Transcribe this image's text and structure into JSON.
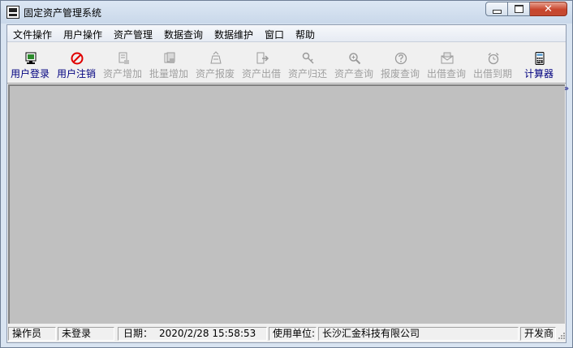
{
  "window": {
    "title": "固定资产管理系统",
    "colors": {
      "title_bar": "#c9d8ea",
      "close_button": "#c8452d",
      "workspace": "#c0c0c0"
    }
  },
  "menu": [
    {
      "label": "文件操作"
    },
    {
      "label": "用户操作"
    },
    {
      "label": "资产管理"
    },
    {
      "label": "数据查询"
    },
    {
      "label": "数据维护"
    },
    {
      "label": "窗口"
    },
    {
      "label": "帮助"
    }
  ],
  "toolbar": [
    {
      "label": "用户登录",
      "icon": "monitor-icon",
      "enabled": true
    },
    {
      "label": "用户注销",
      "icon": "no-entry-icon",
      "enabled": true
    },
    {
      "label": "资产增加",
      "icon": "doc-add-icon",
      "enabled": false
    },
    {
      "label": "批量增加",
      "icon": "batch-add-icon",
      "enabled": false
    },
    {
      "label": "资产报废",
      "icon": "scrap-icon",
      "enabled": false
    },
    {
      "label": "资产出借",
      "icon": "lend-icon",
      "enabled": false
    },
    {
      "label": "资产归还",
      "icon": "key-icon",
      "enabled": false
    },
    {
      "label": "资产查询",
      "icon": "magnifier-icon",
      "enabled": false
    },
    {
      "label": "报废查询",
      "icon": "question-icon",
      "enabled": false
    },
    {
      "label": "出借查询",
      "icon": "mail-icon",
      "enabled": false
    },
    {
      "label": "出借到期",
      "icon": "alarm-clock-icon",
      "enabled": false
    },
    {
      "label": "计算器",
      "icon": "calculator-icon",
      "enabled": true
    }
  ],
  "toolbar_overflow": "»",
  "status": {
    "operator_label": "操作员",
    "operator_value": "未登录",
    "date_label": "日期：",
    "date_value": "2020/2/28 15:58:53",
    "unit_label": "使用单位:",
    "unit_value": "长沙汇金科技有限公司",
    "developer_label": "开发商"
  }
}
